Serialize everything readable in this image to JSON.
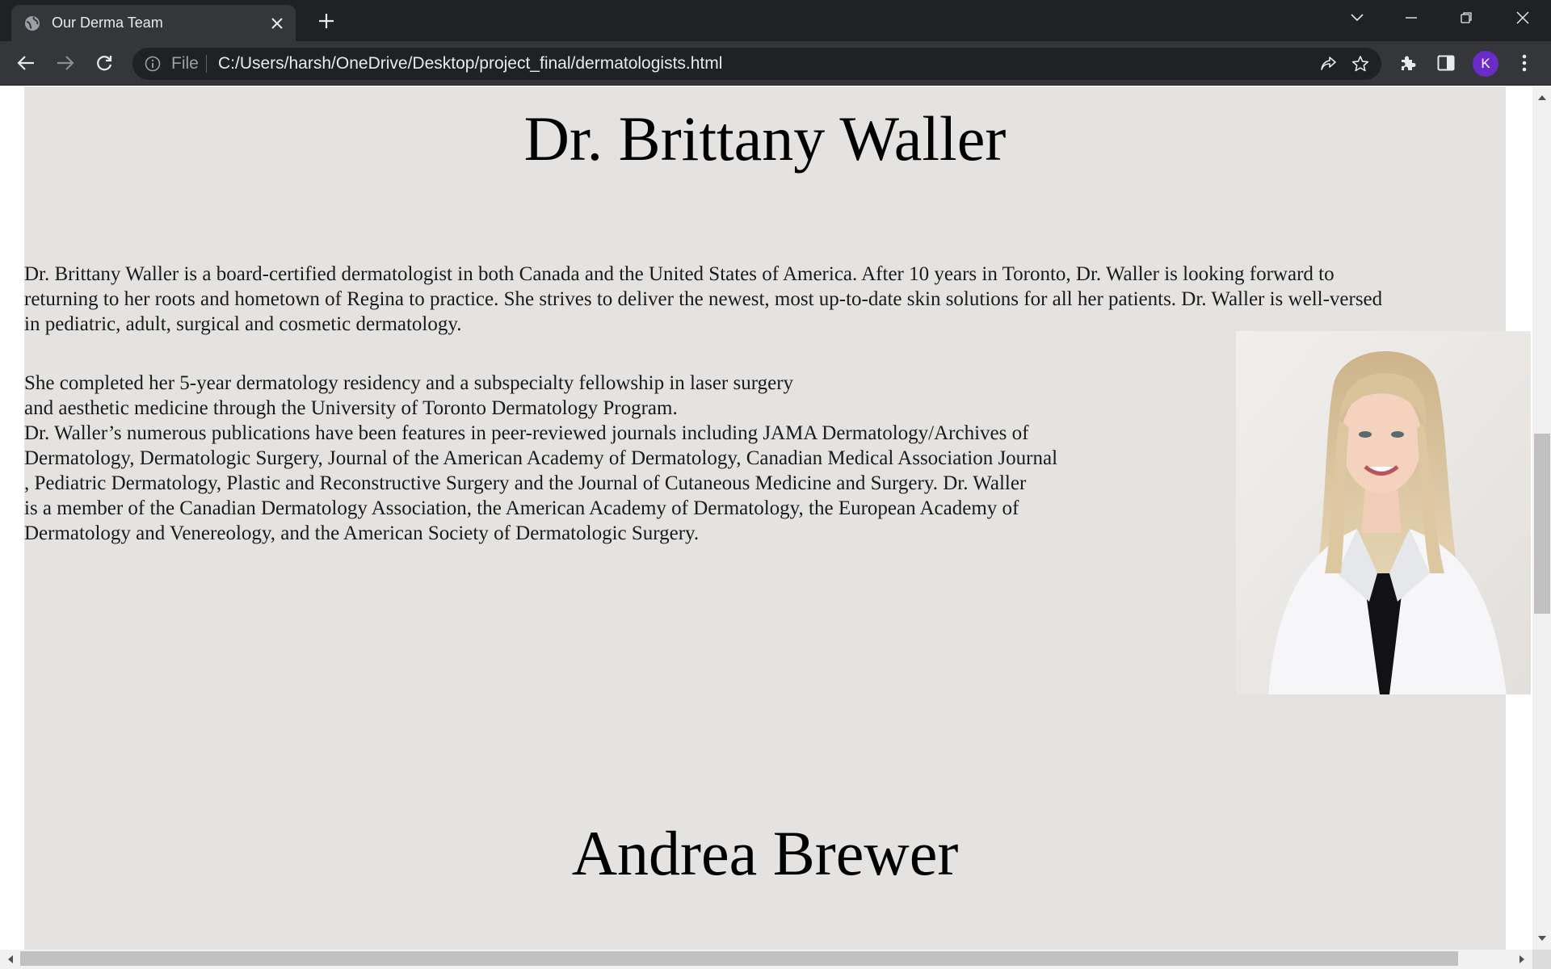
{
  "browser": {
    "tab": {
      "title": "Our Derma Team",
      "favicon": "globe-icon"
    },
    "new_tab_icon": "plus-icon",
    "window_controls": [
      "chevron-down-icon",
      "minimize-icon",
      "restore-icon",
      "close-icon"
    ],
    "address_bar": {
      "scheme_label": "File",
      "url": "C:/Users/harsh/OneDrive/Desktop/project_final/dermatologists.html"
    },
    "profile_initial": "K",
    "profile_color": "#6a2bc7"
  },
  "page": {
    "background": "#e4e3e2",
    "doctors": [
      {
        "name": "Dr. Brittany Waller",
        "bio_paragraph_1": [
          "Dr. Brittany Waller is a board-certified dermatologist in both Canada and the United States of America. After 10 years in Toronto, Dr. Waller is looking forward to",
          "returning to her roots and hometown of Regina to practice. She strives to deliver the newest, most up-to-date skin solutions for all her patients. Dr. Waller is well-versed",
          "in pediatric, adult, surgical and cosmetic dermatology."
        ],
        "bio_paragraph_2": [
          "She completed her 5-year dermatology residency and a subspecialty fellowship in laser surgery",
          "and aesthetic medicine through the University of Toronto Dermatology Program.",
          "Dr. Waller’s numerous publications have been features in peer-reviewed journals including JAMA Dermatology/Archives of",
          "Dermatology, Dermatologic Surgery, Journal of the American Academy of Dermatology, Canadian Medical Association Journal",
          ", Pediatric Dermatology, Plastic and Reconstructive Surgery and the Journal of Cutaneous Medicine and Surgery. Dr. Waller",
          "is a member of the Canadian Dermatology Association, the American Academy of Dermatology, the European Academy of",
          "Dermatology and Venereology, and the American Society of Dermatologic Surgery."
        ]
      },
      {
        "name": "Andrea Brewer"
      }
    ]
  }
}
